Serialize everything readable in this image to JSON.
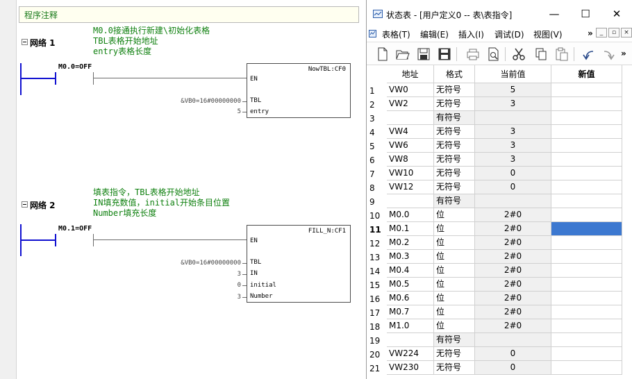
{
  "ladder": {
    "program_comment": "程序注释",
    "networks": [
      {
        "title": "网络 1",
        "comment_lines": [
          "M0.0接通执行新建\\初始化表格",
          "TBL表格开始地址",
          "entry表格长度"
        ],
        "contact_label": "M0.0=OFF",
        "box_name": "NowTBL:CF0",
        "pins": {
          "en": "EN",
          "p1": "TBL",
          "p2": "entry"
        },
        "params": {
          "p1": "&VB0=16#00000000",
          "p2": "5"
        }
      },
      {
        "title": "网络 2",
        "comment_lines": [
          "填表指令，TBL表格开始地址",
          "IN填充数值，initial开始条目位置",
          "Number填充长度"
        ],
        "contact_label": "M0.1=OFF",
        "box_name": "FILL_N:CF1",
        "pins": {
          "en": "EN",
          "p1": "TBL",
          "p2": "IN",
          "p3": "initial",
          "p4": "Number"
        },
        "params": {
          "p1": "&VB0=16#00000000",
          "p2": "3",
          "p3": "0",
          "p4": "3"
        }
      }
    ]
  },
  "window": {
    "title": "状态表 - [用户定义0 -- 表\\表指令]",
    "controls": {
      "minimize": "—",
      "maximize": "☐",
      "close": "✕"
    },
    "menu": [
      "表格(T)",
      "编辑(E)",
      "插入(I)",
      "调试(D)",
      "视图(V)"
    ],
    "menu_overflow": "»",
    "toolbar_overflow": "»",
    "columns": {
      "address": "地址",
      "format": "格式",
      "current": "当前值",
      "new": "新值"
    },
    "selected_row": 11,
    "rows": [
      {
        "num": "1",
        "address": "VW0",
        "format": "无符号",
        "current": "5"
      },
      {
        "num": "2",
        "address": "VW2",
        "format": "无符号",
        "current": "3"
      },
      {
        "num": "3",
        "address": "",
        "format": "有符号",
        "current": ""
      },
      {
        "num": "4",
        "address": "VW4",
        "format": "无符号",
        "current": "3"
      },
      {
        "num": "5",
        "address": "VW6",
        "format": "无符号",
        "current": "3"
      },
      {
        "num": "6",
        "address": "VW8",
        "format": "无符号",
        "current": "3"
      },
      {
        "num": "7",
        "address": "VW10",
        "format": "无符号",
        "current": "0"
      },
      {
        "num": "8",
        "address": "VW12",
        "format": "无符号",
        "current": "0"
      },
      {
        "num": "9",
        "address": "",
        "format": "有符号",
        "current": ""
      },
      {
        "num": "10",
        "address": "M0.0",
        "format": "位",
        "current": "2#0"
      },
      {
        "num": "11",
        "address": "M0.1",
        "format": "位",
        "current": "2#0"
      },
      {
        "num": "12",
        "address": "M0.2",
        "format": "位",
        "current": "2#0"
      },
      {
        "num": "13",
        "address": "M0.3",
        "format": "位",
        "current": "2#0"
      },
      {
        "num": "14",
        "address": "M0.4",
        "format": "位",
        "current": "2#0"
      },
      {
        "num": "15",
        "address": "M0.5",
        "format": "位",
        "current": "2#0"
      },
      {
        "num": "16",
        "address": "M0.6",
        "format": "位",
        "current": "2#0"
      },
      {
        "num": "17",
        "address": "M0.7",
        "format": "位",
        "current": "2#0"
      },
      {
        "num": "18",
        "address": "M1.0",
        "format": "位",
        "current": "2#0"
      },
      {
        "num": "19",
        "address": "",
        "format": "有符号",
        "current": ""
      },
      {
        "num": "20",
        "address": "VW224",
        "format": "无符号",
        "current": "0"
      },
      {
        "num": "21",
        "address": "VW230",
        "format": "无符号",
        "current": "0"
      }
    ]
  }
}
